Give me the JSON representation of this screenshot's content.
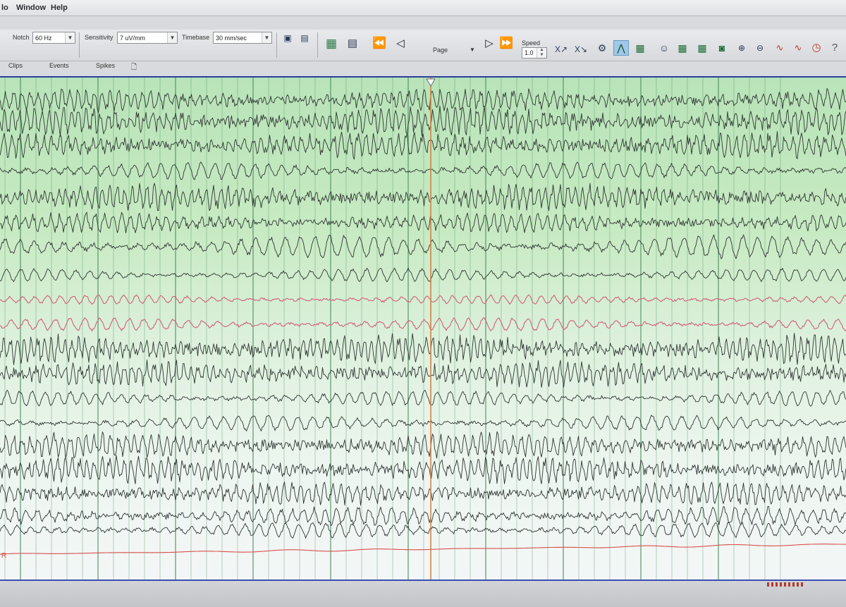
{
  "menu": [
    "lo",
    "Window",
    "Help"
  ],
  "toolbar": {
    "notch_label": "Notch",
    "notch_value": "60 Hz",
    "sensitivity_label": "Sensitivity",
    "sensitivity_value": "7 uV/mm",
    "timebase_label": "Timebase",
    "timebase_value": "30 mm/sec",
    "page_label": "Page",
    "speed_label": "Speed",
    "speed_value": "1.0"
  },
  "tabs": [
    "Clips",
    "Events",
    "Spikes"
  ],
  "channel_labels": [
    "R"
  ],
  "colors": {
    "trace": "#2f3532",
    "trace_pink": "#d0607a",
    "trace_ecg": "#d8504f",
    "cursor": "#d27a3c",
    "gridline": "#4f8f63",
    "accent": "#2b3f9a"
  }
}
